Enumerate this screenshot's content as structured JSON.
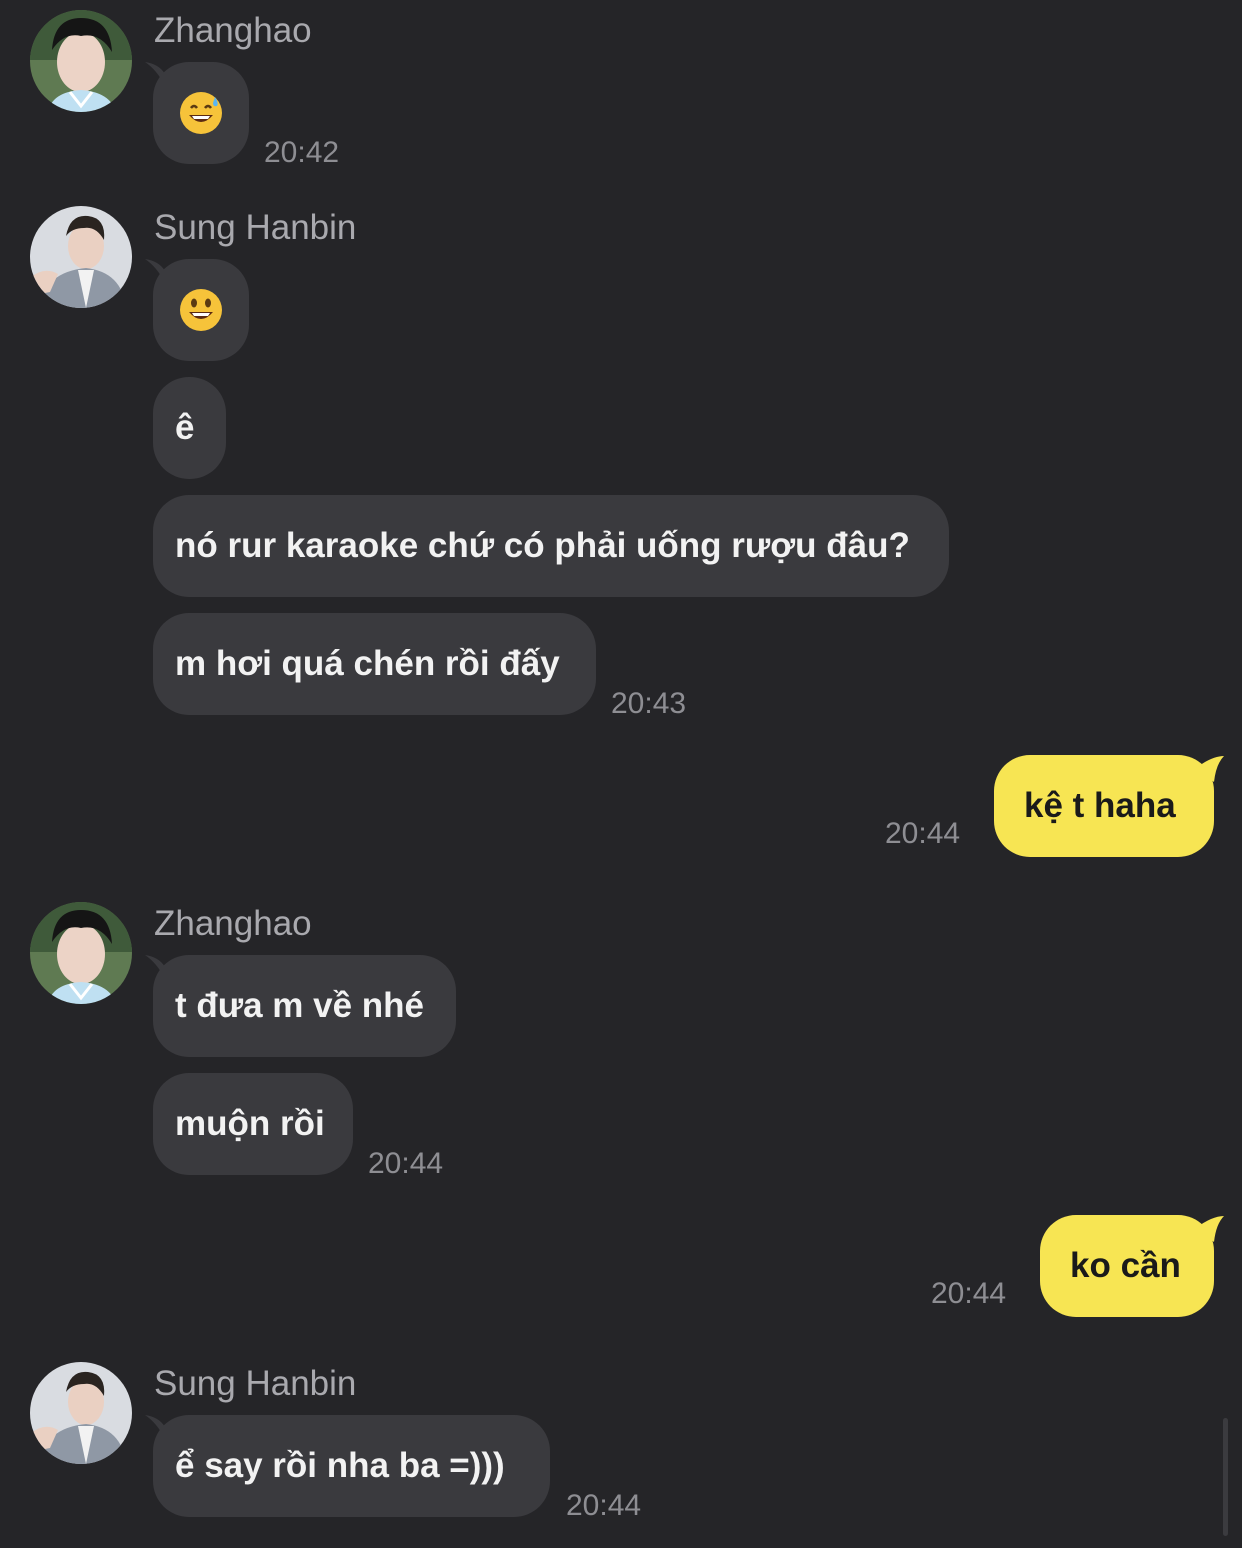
{
  "messages": [
    {
      "sender": "Zhanghao",
      "emoji": "sweat-smile-emoji",
      "time": "20:42"
    },
    {
      "sender": "Sung Hanbin",
      "emoji": "smile-emoji",
      "text2": "ê",
      "text3": "nó rur karaoke chứ có phải uống rượu đâu?",
      "text4": "m hơi quá chén rồi đấy",
      "time": "20:43"
    },
    {
      "me": true,
      "text": "kệ t haha",
      "time": "20:44"
    },
    {
      "sender": "Zhanghao",
      "text1": "t đưa m về nhé",
      "text2": "muộn rồi",
      "time": "20:44"
    },
    {
      "me": true,
      "text": "ko cần",
      "time": "20:44"
    },
    {
      "sender": "Sung Hanbin",
      "text1": "ể say rồi nha ba =)))",
      "time": "20:44"
    }
  ],
  "colors": {
    "background": "#252528",
    "incoming_bubble": "#3a3a3e",
    "outgoing_bubble": "#f7e553",
    "timestamp": "#8e8e93"
  }
}
